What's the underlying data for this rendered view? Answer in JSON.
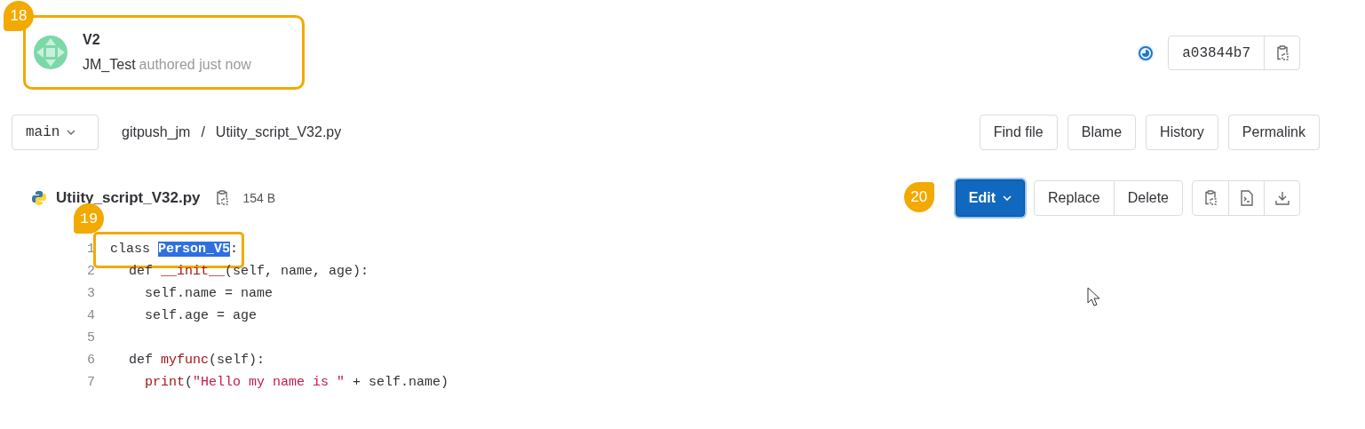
{
  "commit": {
    "callout": "18",
    "title": "V2",
    "author": "JM_Test",
    "meta": "authored just now"
  },
  "sha": "a03844b7",
  "branch": "main",
  "breadcrumb": [
    "gitpush_jm",
    "/",
    "Utiity_script_V32.py"
  ],
  "actions": [
    "Find file",
    "Blame",
    "History",
    "Permalink"
  ],
  "file": {
    "name": "Utiity_script_V32.py",
    "size": "154 B"
  },
  "edit_button": {
    "label": "Edit",
    "callout": "20"
  },
  "file_buttons": [
    "Replace",
    "Delete"
  ],
  "code": [
    {
      "number": "1",
      "callout": "19",
      "tokens": [
        {
          "text": "class ",
          "kind": "plain"
        },
        {
          "text": "Person_V5",
          "kind": "selected"
        },
        {
          "text": ":",
          "kind": "plain"
        }
      ]
    },
    {
      "number": "2",
      "tokens": [
        {
          "text": "  def ",
          "kind": "plain"
        },
        {
          "text": "__init__",
          "kind": "name"
        },
        {
          "text": "(self, name, age):",
          "kind": "plain"
        }
      ]
    },
    {
      "number": "3",
      "tokens": [
        {
          "text": "    self.name = name",
          "kind": "plain"
        }
      ]
    },
    {
      "number": "4",
      "tokens": [
        {
          "text": "    self.age = age",
          "kind": "plain"
        }
      ]
    },
    {
      "number": "5"
    },
    {
      "number": "6",
      "tokens": [
        {
          "text": "  def ",
          "kind": "plain"
        },
        {
          "text": "myfunc",
          "kind": "name"
        },
        {
          "text": "(self):",
          "kind": "plain"
        }
      ]
    },
    {
      "number": "7",
      "tokens": [
        {
          "text": "    print",
          "kind": "name"
        },
        {
          "text": "(",
          "kind": "plain"
        },
        {
          "text": "\"Hello my name is \"",
          "kind": "string"
        },
        {
          "text": " + self.name)",
          "kind": "plain"
        }
      ]
    }
  ]
}
